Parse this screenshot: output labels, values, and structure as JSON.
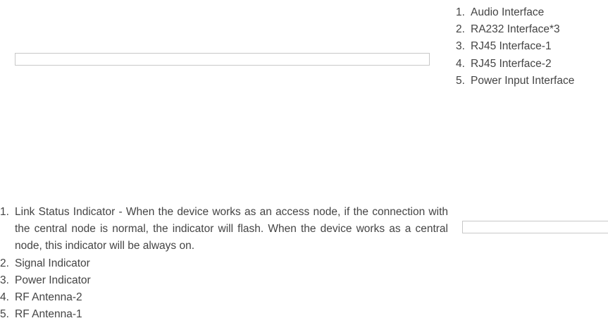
{
  "rear_panel": {
    "items": [
      {
        "num": "1.",
        "label": "Audio Interface"
      },
      {
        "num": "2.",
        "label": "RA232 Interface*3"
      },
      {
        "num": "3.",
        "label": "RJ45 Interface-1"
      },
      {
        "num": "4.",
        "label": "RJ45 Interface-2"
      },
      {
        "num": "5.",
        "label": "Power Input Interface"
      }
    ]
  },
  "front_panel": {
    "items": [
      {
        "num": "1.",
        "label": "Link Status Indicator - When the device works as an access node, if the connection with the central node is normal, the indicator will flash. When the device works as a central node, this indicator will be always on."
      },
      {
        "num": "2.",
        "label": "Signal Indicator"
      },
      {
        "num": "3.",
        "label": "Power Indicator"
      },
      {
        "num": "4.",
        "label": "RF Antenna-2"
      },
      {
        "num": "5.",
        "label": "RF Antenna-1"
      }
    ]
  }
}
